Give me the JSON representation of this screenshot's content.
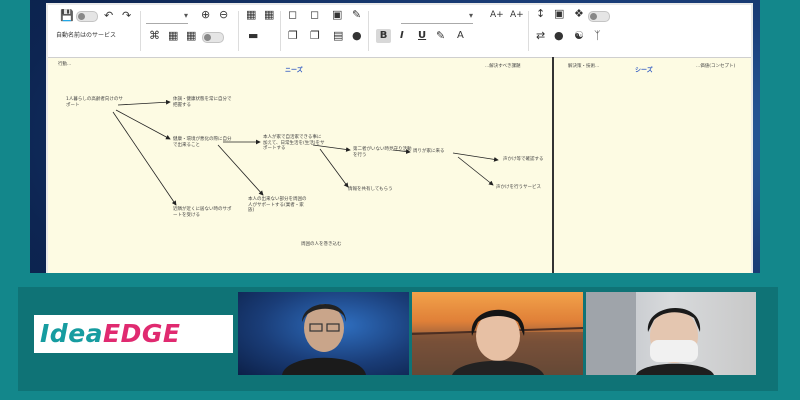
{
  "toolbar": {
    "dropdown_font_value": "",
    "dropdown_size_value": "",
    "row2_label": "自動名前はのサービス",
    "bold": "B",
    "italic": "I",
    "underline": "U",
    "font_color": "A",
    "grow_font": "A+",
    "shrink_font": "A+"
  },
  "canvas": {
    "left_col_header": "行動...",
    "col1_title": "ニーズ",
    "col1_right_note": "...解決すべき課題",
    "col2_left_note": "解決策・技術...",
    "col2_title": "シーズ",
    "col2_right_note": "...価値(コンセプト)",
    "nodes": {
      "n1": "1人暮らしの高齢者向けのサポート",
      "n2": "体調・健康状態を常に自分で把握する",
      "n3": "健康・環境が悪化の際に自分で出来ること",
      "n4": "本人が家で自活家できる事に加えて、日常生活を(生活)をサポートする",
      "n5": "第二者がいない時見守り活動を行う",
      "n6": "本人の出来ない部分を周囲の人がサポートする(業者・家族)",
      "n7": "周囲の人を巻き込む",
      "n8": "近隣が近くに居ない時のサポートを受ける",
      "n9": "情報を共有してもらう",
      "n10": "周りが家に来る",
      "n11": "声かけ等で確認する",
      "n12": "声かけを行うサービス",
      "n13": "みんなで参加しつつ"
    }
  },
  "brand": {
    "logo_part1": "Idea",
    "logo_part2": "EDGE"
  },
  "colors": {
    "teal": "#13878b",
    "logo_blue": "#169ca0",
    "logo_pink": "#e02a70",
    "note_bg": "#fdfbe3",
    "header_blue": "#2b56c2"
  }
}
